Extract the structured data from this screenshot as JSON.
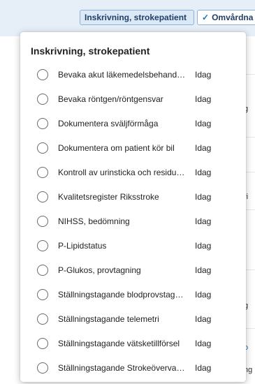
{
  "toolbar": {
    "chips": [
      {
        "label": "Inskrivning, strokepatient",
        "checked": false
      },
      {
        "label": "Omvårdna",
        "checked": true
      }
    ]
  },
  "background_fragments": [
    "g",
    "ri",
    "g",
    "o",
    "ng"
  ],
  "popover": {
    "title": "Inskrivning, strokepatient",
    "items": [
      {
        "label": "Bevaka akut läkemedelsbehand…",
        "due": "Idag",
        "checked": false
      },
      {
        "label": "Bevaka röntgen/röntgensvar",
        "due": "Idag",
        "checked": false
      },
      {
        "label": "Dokumentera sväljförmåga",
        "due": "Idag",
        "checked": false
      },
      {
        "label": "Dokumentera om patient kör bil",
        "due": "Idag",
        "checked": false
      },
      {
        "label": "Kontroll av urinsticka och residu…",
        "due": "Idag",
        "checked": false
      },
      {
        "label": "Kvalitetsregister Riksstroke",
        "due": "Idag",
        "checked": false
      },
      {
        "label": "NIHSS, bedömning",
        "due": "Idag",
        "checked": false
      },
      {
        "label": "P-Lipidstatus",
        "due": "Idag",
        "checked": false
      },
      {
        "label": "P-Glukos, provtagning",
        "due": "Idag",
        "checked": false
      },
      {
        "label": "Ställningstagande blodprovstag…",
        "due": "Idag",
        "checked": false
      },
      {
        "label": "Ställningstagande telemetri",
        "due": "Idag",
        "checked": false
      },
      {
        "label": "Ställningstagande vätsketillförsel",
        "due": "Idag",
        "checked": false
      },
      {
        "label": "Ställningstagande Strokeöverva…",
        "due": "Idag",
        "checked": false
      }
    ]
  }
}
